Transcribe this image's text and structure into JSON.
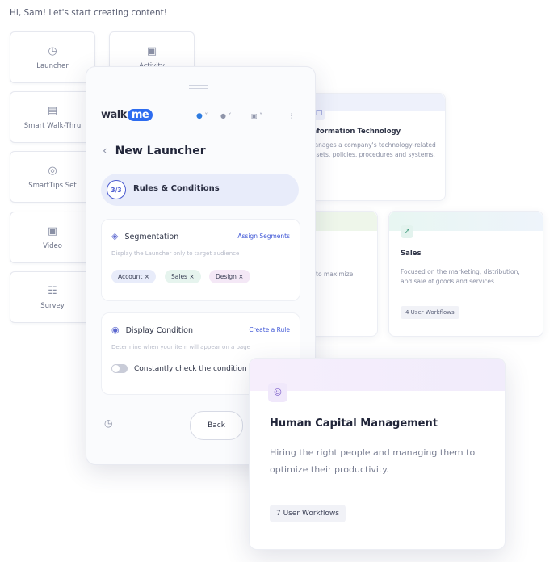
{
  "greeting": "Hi, Sam! Let's start creating content!",
  "tiles": [
    {
      "label": "Launcher",
      "icon": "launcher-icon"
    },
    {
      "label": "Activity",
      "icon": "activity-icon"
    },
    {
      "label": "Smart Walk-Thru",
      "icon": "walkthru-icon"
    },
    {
      "label": "SmartTips Set",
      "icon": "smarttips-icon"
    },
    {
      "label": "Video",
      "icon": "video-icon"
    },
    {
      "label": "Survey",
      "icon": "survey-icon"
    }
  ],
  "cards": {
    "it": {
      "title": "Information Technology",
      "desc_line1": "Manages a company's technology-related",
      "desc_line2": "assets, policies, procedures and systems."
    },
    "partial": {
      "desc": "to maximize"
    },
    "sales": {
      "title": "Sales",
      "desc_line1": "Focused on the marketing, distribution,",
      "desc_line2": "and sale of goods and services.",
      "workflows": "4 User Workflows"
    },
    "hcm": {
      "title": "Human Capital Management",
      "desc": "Hiring the right people and managing them to optimize their productivity.",
      "workflows": "7 User Workflows"
    }
  },
  "panel": {
    "logo_walk": "walk",
    "logo_me": "me",
    "title": "New Launcher",
    "step": {
      "badge": "3/3",
      "label": "Rules & Conditions"
    },
    "segmentation": {
      "title": "Segmentation",
      "link": "Assign Segments",
      "desc": "Display the Launcher only to target audience",
      "tags": [
        "Account",
        "Sales",
        "Design"
      ]
    },
    "display_condition": {
      "title": "Display Condition",
      "link": "Create a Rule",
      "desc": "Determine when your item will appear on a page",
      "toggle_label": "Constantly check the condition"
    },
    "back_label": "Back"
  },
  "colors": {
    "accent": "#3e56d6",
    "logo_badge": "#2d6cf0",
    "tag_account": "#e8ecfa",
    "tag_sales": "#e6f4ee",
    "tag_design": "#f4e8f6"
  }
}
